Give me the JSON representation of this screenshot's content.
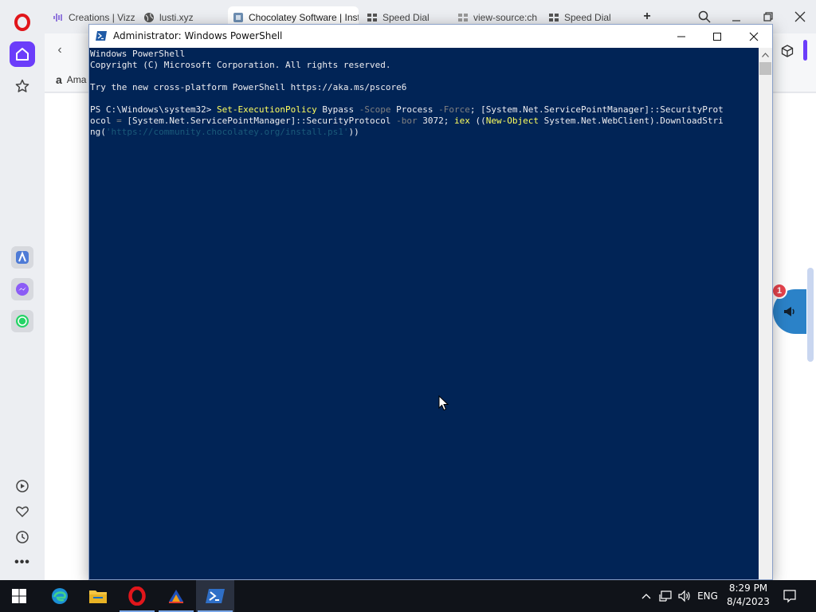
{
  "browser": {
    "tabs": [
      {
        "label": "Creations | Vizz",
        "icon": "waveform-icon"
      },
      {
        "label": "lusti.xyz",
        "icon": "globe-icon"
      },
      {
        "label": "Chocolatey Software | Inst",
        "icon": "chocolatey-icon",
        "active": true
      },
      {
        "label": "Speed Dial",
        "icon": "grid-icon"
      },
      {
        "label": "view-source:ch",
        "icon": "grid-icon"
      },
      {
        "label": "Speed Dial",
        "icon": "grid-icon"
      }
    ],
    "bookmark": {
      "label": "Ama",
      "icon": "amazon-icon"
    },
    "promo_badge": "1"
  },
  "powershell": {
    "title": "Administrator: Windows PowerShell",
    "lines": {
      "l1": "Windows PowerShell",
      "l2": "Copyright (C) Microsoft Corporation. All rights reserved.",
      "l3": "Try the new cross-platform PowerShell https://aka.ms/pscore6",
      "l4_prompt": "PS C:\\Windows\\system32> ",
      "l4_cmd": "Set-ExecutionPolicy",
      "l4_a": " Bypass ",
      "l4_p1": "-Scope",
      "l4_b": " Process ",
      "l4_p2": "-Force",
      "l4_c": "; [System.Net.ServicePointManager]::SecurityProt",
      "l5_a": "ocol ",
      "l5_eq": "=",
      "l5_b": " [System.Net.ServicePointManager]::SecurityProtocol ",
      "l5_p": "-bor",
      "l5_c": " 3072; ",
      "l5_iex": "iex",
      "l5_d": " ((",
      "l5_new": "New-Object",
      "l5_e": " System.Net.WebClient).DownloadStri",
      "l6_a": "ng(",
      "l6_str": "'https://community.chocolatey.org/install.ps1'",
      "l6_b": "))"
    }
  },
  "taskbar": {
    "apps": [
      "windows-start-icon",
      "edge-icon",
      "file-explorer-icon",
      "opera-icon",
      "app-icon",
      "powershell-icon"
    ],
    "language": "ENG",
    "time": "8:29 PM",
    "date": "8/4/2023"
  },
  "colors": {
    "console_bg": "#012456",
    "command_yellow": "#ffff5f",
    "param_gray": "#808080",
    "opera_red": "#e1161b",
    "opera_purple": "#6b3dfa"
  }
}
